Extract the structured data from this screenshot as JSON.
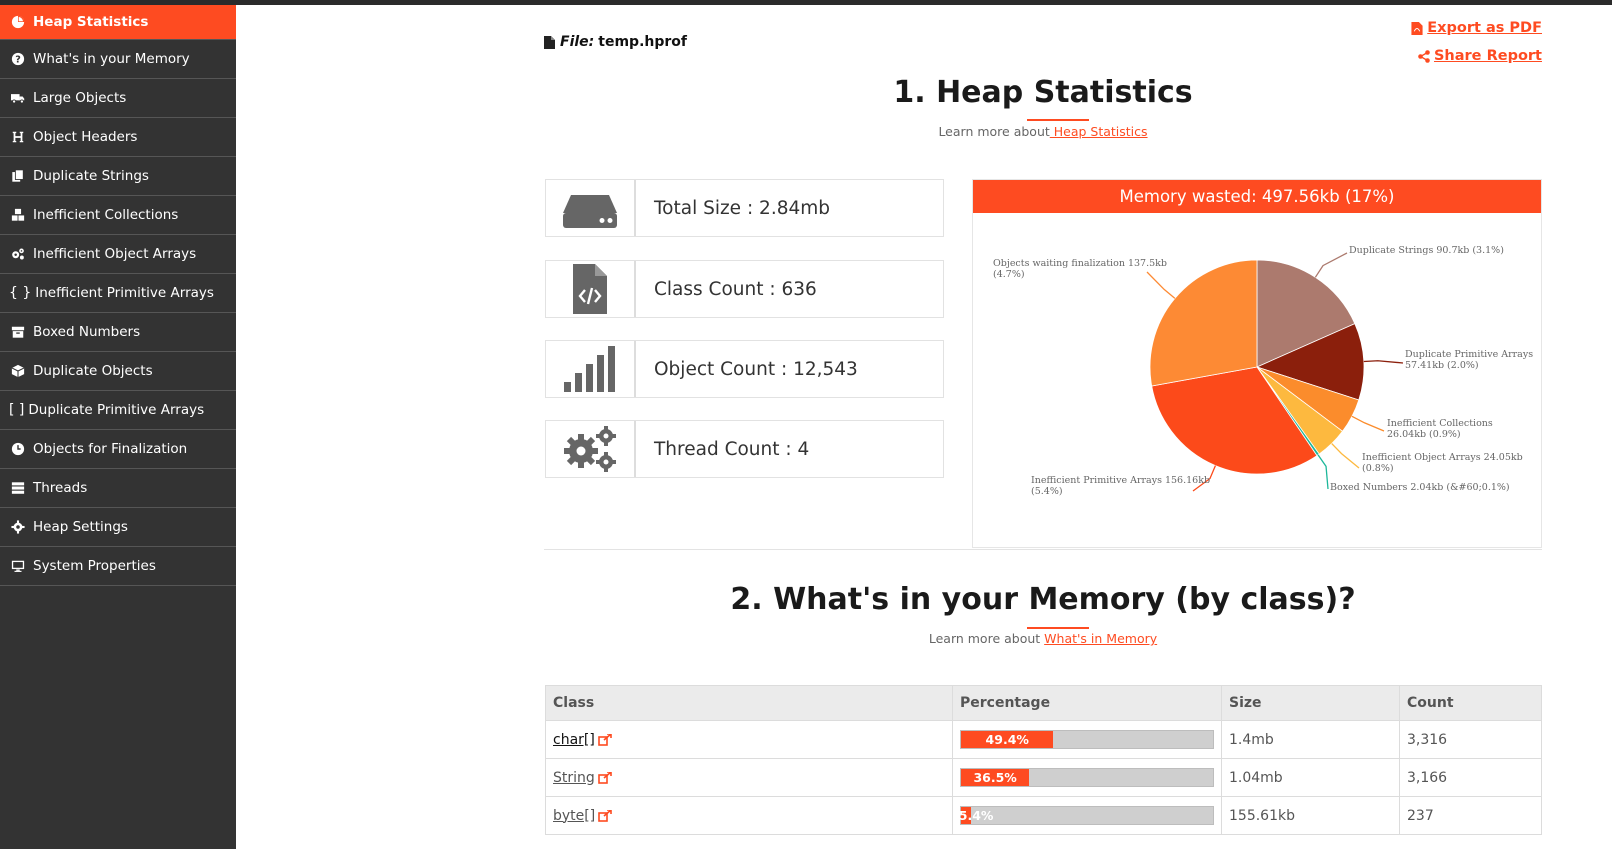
{
  "sidebar": {
    "items": [
      {
        "label": "Heap Statistics",
        "icon": "pie-chart-icon"
      },
      {
        "label": "What's in your Memory",
        "icon": "question-circle-icon"
      },
      {
        "label": "Large Objects",
        "icon": "truck-icon"
      },
      {
        "label": "Object Headers",
        "icon": "header-icon"
      },
      {
        "label": "Duplicate Strings",
        "icon": "copy-icon"
      },
      {
        "label": "Inefficient Collections",
        "icon": "cubes-icon"
      },
      {
        "label": "Inefficient Object Arrays",
        "icon": "cogs-icon"
      },
      {
        "label": "Inefficient Primitive Arrays",
        "icon": "braces-icon",
        "glyph": "{ }"
      },
      {
        "label": "Boxed Numbers",
        "icon": "archive-icon"
      },
      {
        "label": "Duplicate Objects",
        "icon": "cube-icon"
      },
      {
        "label": "Duplicate Primitive Arrays",
        "icon": "brackets-icon",
        "glyph": "[ ]"
      },
      {
        "label": "Objects for Finalization",
        "icon": "clock-icon"
      },
      {
        "label": "Threads",
        "icon": "server-icon"
      },
      {
        "label": "Heap Settings",
        "icon": "gear-icon"
      },
      {
        "label": "System Properties",
        "icon": "desktop-icon"
      }
    ]
  },
  "file": {
    "prefix": "File:",
    "name": "temp.hprof"
  },
  "actions": {
    "export": "Export as PDF",
    "share": "Share Report"
  },
  "section1": {
    "title": "1. Heap Statistics",
    "learn_prefix": "Learn more about",
    "learn_link": " Heap Statistics"
  },
  "stats": [
    {
      "label": "Total Size : 2.84mb",
      "icon": "hdd-icon"
    },
    {
      "label": "Class Count : 636",
      "icon": "file-code-icon"
    },
    {
      "label": "Object Count : 12,543",
      "icon": "signal-bars-icon"
    },
    {
      "label": "Thread Count : 4",
      "icon": "gears-icon"
    }
  ],
  "memory_wasted": "Memory wasted: 497.56kb (17%)",
  "chart_data": {
    "type": "pie",
    "title": "Memory wasted: 497.56kb (17%)",
    "slices": [
      {
        "name": "Duplicate Strings",
        "label": "Duplicate Strings 90.7kb (3.1%)",
        "value": 90.7,
        "color": "#ac7a6e"
      },
      {
        "name": "Duplicate Primitive Arrays",
        "label": "Duplicate Primitive Arrays 57.41kb (2.0%)",
        "value": 57.41,
        "color": "#8b1f0c"
      },
      {
        "name": "Inefficient Collections",
        "label": "Inefficient Collections 26.04kb (0.9%)",
        "value": 26.04,
        "color": "#fb8c2c"
      },
      {
        "name": "Inefficient Object Arrays",
        "label": "Inefficient Object Arrays 24.05kb (0.8%)",
        "value": 24.05,
        "color": "#fdb93f"
      },
      {
        "name": "Boxed Numbers",
        "label": "Boxed Numbers 2.04kb (&#60;0.1%)",
        "value": 2.04,
        "color": "#1cb79a"
      },
      {
        "name": "Inefficient Primitive Arrays",
        "label": "Inefficient Primitive Arrays 156.16kb (5.4%)",
        "value": 156.16,
        "color": "#fc4a1a"
      },
      {
        "name": "Objects waiting finalization",
        "label": "Objects waiting finalization 137.5kb (4.7%)",
        "value": 137.5,
        "color": "#fd8a34"
      }
    ]
  },
  "section2": {
    "title": "2. What's in your Memory (by class)?",
    "learn_prefix": "Learn more about ",
    "learn_link": "What's in Memory"
  },
  "table": {
    "headers": [
      "Class",
      "Percentage",
      "Size",
      "Count"
    ],
    "rows": [
      {
        "cls": "char[]",
        "pct": 49.4,
        "pct_label": "49.4%",
        "size": "1.4mb",
        "count": "3,316"
      },
      {
        "cls": "String",
        "pct": 36.5,
        "pct_label": "36.5%",
        "size": "1.04mb",
        "count": "3,166"
      },
      {
        "cls": "byte[]",
        "pct": 5.4,
        "pct_label": "5.4%",
        "size": "155.61kb",
        "count": "237"
      }
    ]
  }
}
